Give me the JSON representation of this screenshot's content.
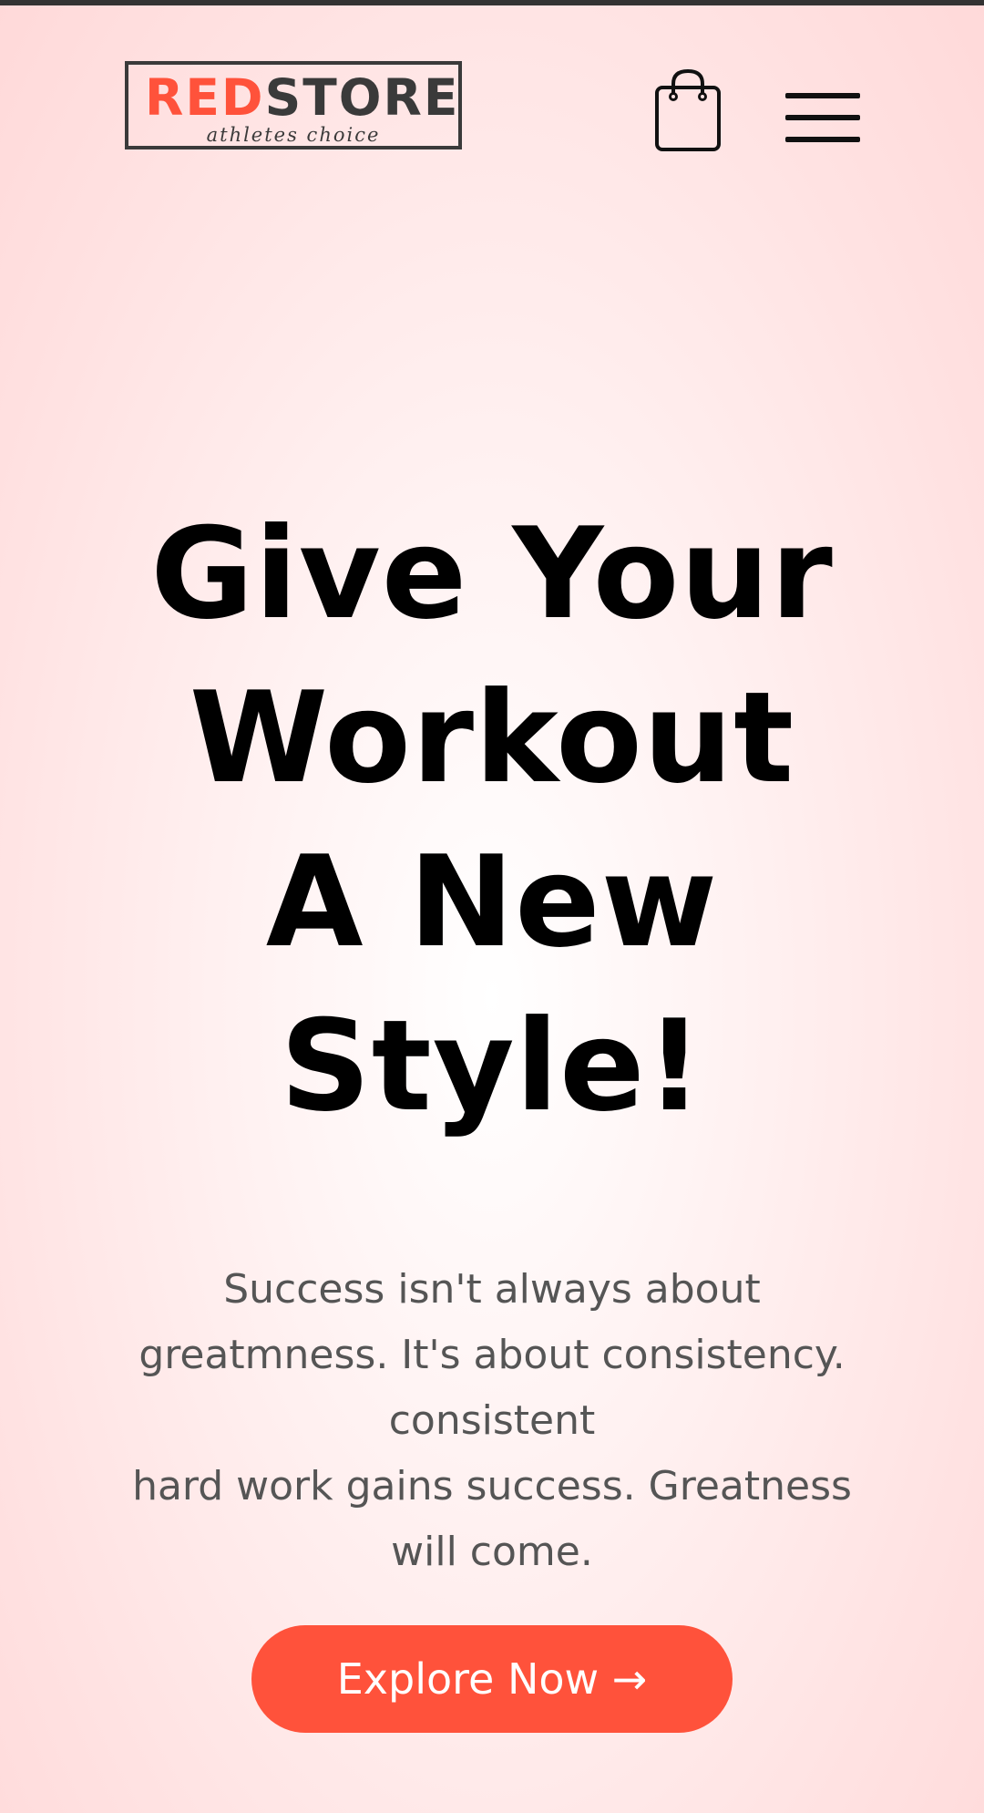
{
  "header": {
    "logo": {
      "brand_red": "RED",
      "brand_dark": "STORE",
      "tagline": "athletes choice"
    },
    "cart_icon": "shopping-bag-icon",
    "menu_icon": "hamburger-menu-icon"
  },
  "hero": {
    "title_lines": [
      "Give Your",
      "Workout",
      "A New",
      "Style!"
    ],
    "text_lines": [
      "Success isn't always about",
      "greatmness. It's about consistency.",
      "consistent",
      "hard work gains success. Greatness",
      "will come."
    ],
    "cta_label": "Explore Now →"
  },
  "colors": {
    "accent": "#ff523b",
    "text_dark": "#000000",
    "text_muted": "#555555",
    "logo_dark": "#3a3a3a"
  }
}
